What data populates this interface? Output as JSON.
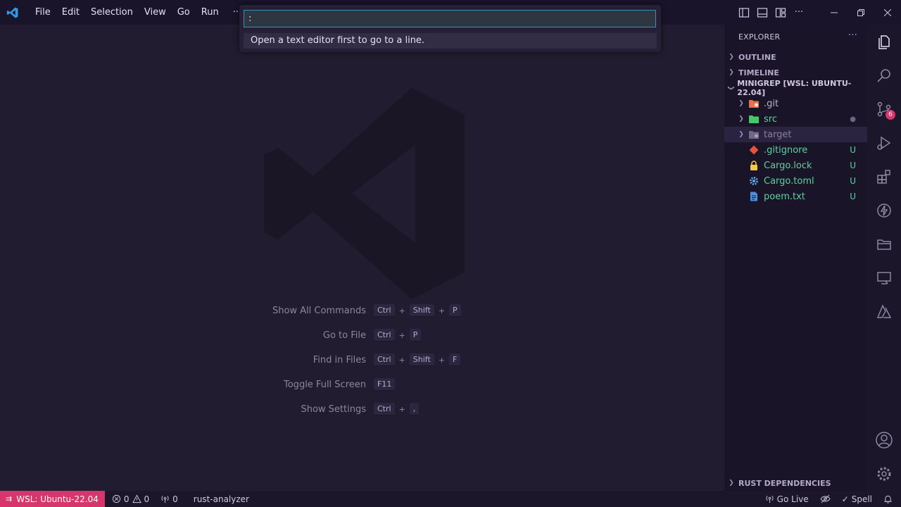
{
  "menu": [
    "File",
    "Edit",
    "Selection",
    "View",
    "Go",
    "Run",
    "···"
  ],
  "quick_input": {
    "value": ":",
    "message": "Open a text editor first to go to a line."
  },
  "shortcuts": [
    {
      "label": "Show All Commands",
      "keys": [
        "Ctrl",
        "Shift",
        "P"
      ]
    },
    {
      "label": "Go to File",
      "keys": [
        "Ctrl",
        "P"
      ]
    },
    {
      "label": "Find in Files",
      "keys": [
        "Ctrl",
        "Shift",
        "F"
      ]
    },
    {
      "label": "Toggle Full Screen",
      "keys": [
        "F11"
      ]
    },
    {
      "label": "Show Settings",
      "keys": [
        "Ctrl",
        ","
      ]
    }
  ],
  "sidebar": {
    "title": "EXPLORER",
    "more": "···",
    "sections": {
      "outline": "OUTLINE",
      "timeline": "TIMELINE",
      "workspace": "MINIGREP [WSL: UBUNTU-22.04]",
      "rust_deps": "RUST DEPENDENCIES"
    },
    "tree": [
      {
        "name": ".git",
        "badge": ""
      },
      {
        "name": "src",
        "badge": "●"
      },
      {
        "name": "target",
        "badge": ""
      },
      {
        "name": ".gitignore",
        "badge": "U"
      },
      {
        "name": "Cargo.lock",
        "badge": "U"
      },
      {
        "name": "Cargo.toml",
        "badge": "U"
      },
      {
        "name": "poem.txt",
        "badge": "U"
      }
    ]
  },
  "activity": {
    "scm_badge": "6"
  },
  "statusbar": {
    "remote": "WSL: Ubuntu-22.04",
    "errors": "0",
    "warnings": "0",
    "ports": "0",
    "analyzer": "rust-analyzer",
    "go_live": "Go Live",
    "spell": "Spell"
  },
  "colors": {
    "accent": "#d6366b",
    "folder_git": "#e8704d",
    "folder_src": "#48c764",
    "untracked": "#5fd1a0",
    "ignored": "#8a8099",
    "focus": "#3b8eba"
  }
}
